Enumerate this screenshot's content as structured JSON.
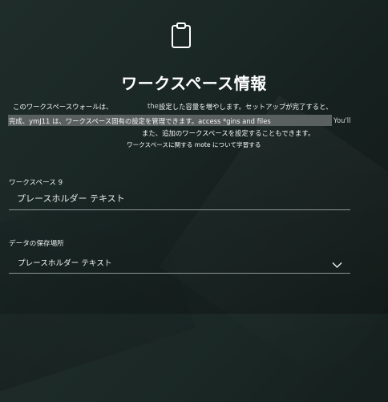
{
  "header": {
    "icon": "clipboard-icon",
    "title": "ワークスペース情報"
  },
  "description": {
    "line1_part1": "このワークスペースウォールは、",
    "line1_part2": "the",
    "line1_part3": "設定した容量を増やします。セットアップが完了すると、",
    "line2": "完成、ymJ11 は、ワークスペース固有の設定を管理できます。access *gins and files",
    "line2_tail": "You'll",
    "line3": "また、追加のワークスペースを設定することもできます。",
    "learn_more_link": "ワークスペースに関する mote について学習する"
  },
  "workspace_field": {
    "label": "ワークスペース 9",
    "placeholder": "プレースホルダー テキスト"
  },
  "storage_field": {
    "label": "データの保存場所",
    "selected_value": "プレースホルダー テキスト",
    "dropdown_icon": "chevron-down-icon"
  }
}
